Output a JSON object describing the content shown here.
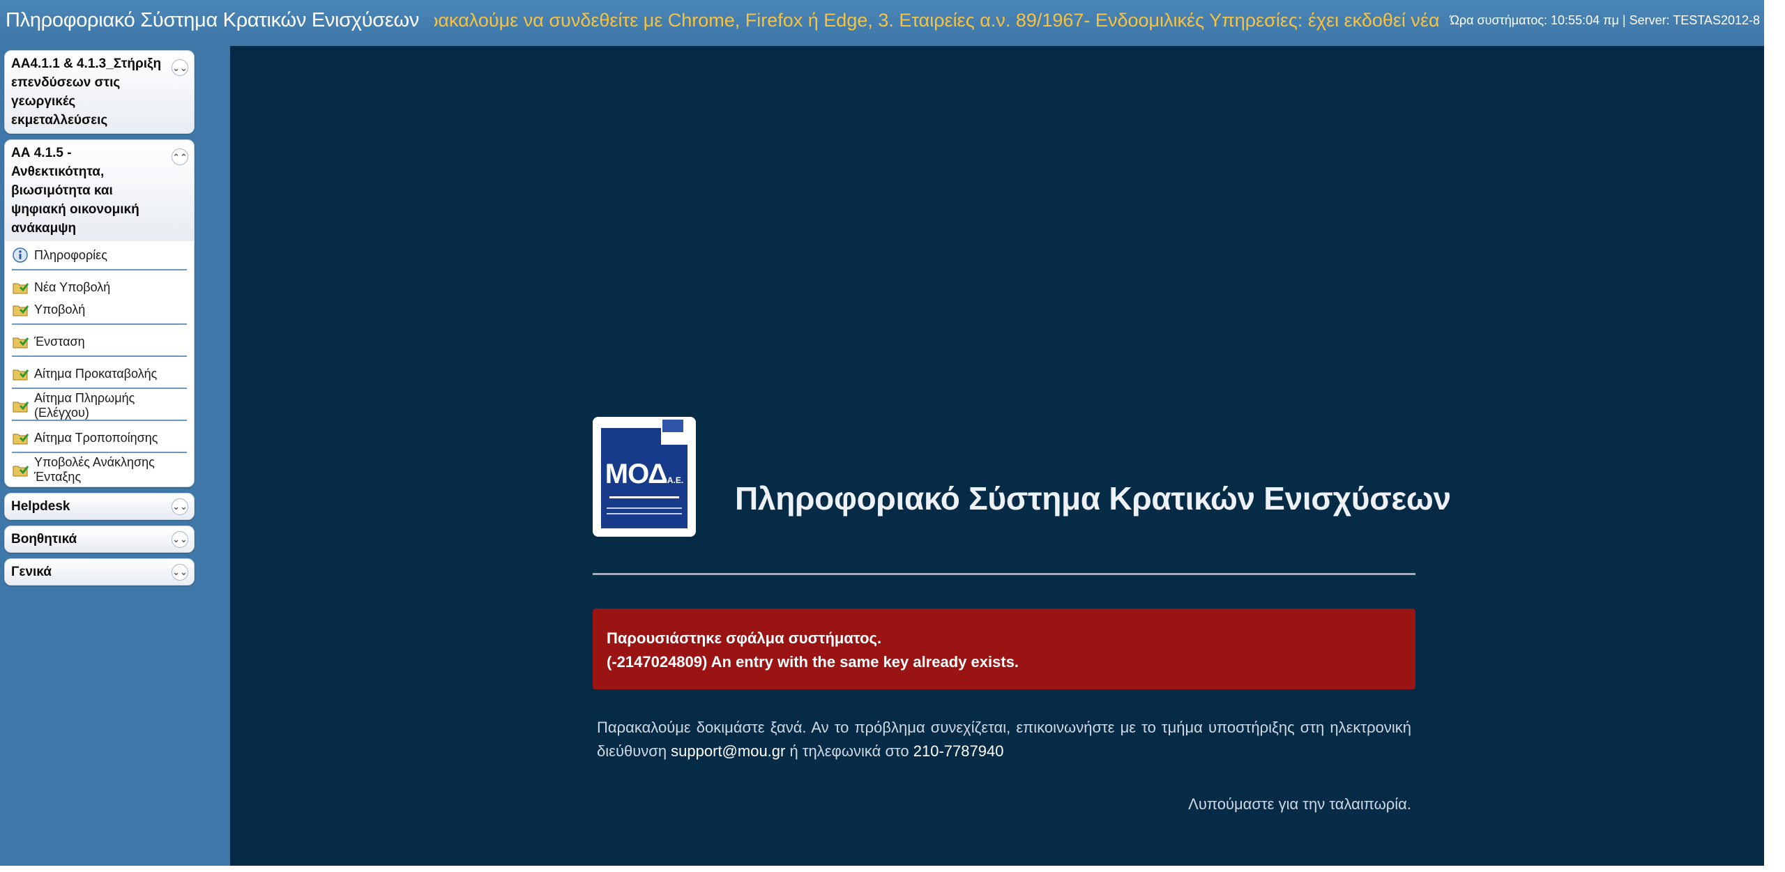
{
  "header": {
    "app_title": "Πληροφοριακό Σύστημα Κρατικών Ενισχύσεων",
    "marquee": "ρακαλούμε να συνδεθείτε με Chrome, Firefox ή Edge, 3. Εταιρείες α.ν. 89/1967- Ενδοομιλικές Υπηρεσίες: έχει εκδοθεί νέα Υπουργική Απόφαση περί Κυρώ",
    "system_info": "Ώρα συστήματος: 10:55:04 πμ | Server: TESTAS2012-8"
  },
  "sidebar": {
    "panels": [
      {
        "title": "ΑΑ4.1.1 & 4.1.3_Στήριξη επενδύσεων στις γεωργικές εκμεταλλεύσεις",
        "state": "collapsed"
      },
      {
        "title": "ΑΑ 4.1.5 - Ανθεκτικότητα, βιωσιμότητα και ψηφιακή οικονομική ανάκαμψη",
        "state": "expanded",
        "items": [
          {
            "label": "Πληροφορίες",
            "icon": "info-icon"
          },
          {
            "label": "Νέα Υποβολή",
            "icon": "folder-icon"
          },
          {
            "label": "Υποβολή",
            "icon": "folder-icon"
          },
          {
            "label": "Ένσταση",
            "icon": "folder-icon"
          },
          {
            "label": "Αίτημα Προκαταβολής",
            "icon": "folder-icon"
          },
          {
            "label": "Αίτημα Πληρωμής (Ελέγχου)",
            "icon": "folder-icon"
          },
          {
            "label": "Αίτημα Τροποποίησης",
            "icon": "folder-icon"
          },
          {
            "label": "Υποβολές Ανάκλησης Ένταξης",
            "icon": "folder-icon"
          }
        ]
      },
      {
        "title": "Helpdesk",
        "state": "collapsed"
      },
      {
        "title": "Βοηθητικά",
        "state": "collapsed"
      },
      {
        "title": "Γενικά",
        "state": "collapsed"
      }
    ]
  },
  "main": {
    "logo_text": "ΜΟΔ",
    "logo_suffix": "Α.Ε.",
    "site_title": "Πληροφοριακό Σύστημα Κρατικών Ενισχύσεων",
    "error": {
      "line1": "Παρουσιάστηκε σφάλμα συστήματος.",
      "line2": "(-2147024809) An entry with the same key already exists."
    },
    "help": {
      "text_before": "Παρακαλούμε δοκιμάστε ξανά. Αν το πρόβλημα συνεχίζεται, επικοινωνήστε με το τμήμα υποστήριξης στη ηλεκτρονική διεύθυνση ",
      "email": "support@mou.gr",
      "text_mid": " ή τηλεφωνικά στο ",
      "phone": "210-7787940"
    },
    "sorry": "Λυπούμαστε για την ταλαιπωρία."
  },
  "colors": {
    "top_bar": "#3f78a8",
    "marquee_text": "#f7c240",
    "main_bg": "#062b47",
    "error_bg": "#9a1414"
  }
}
